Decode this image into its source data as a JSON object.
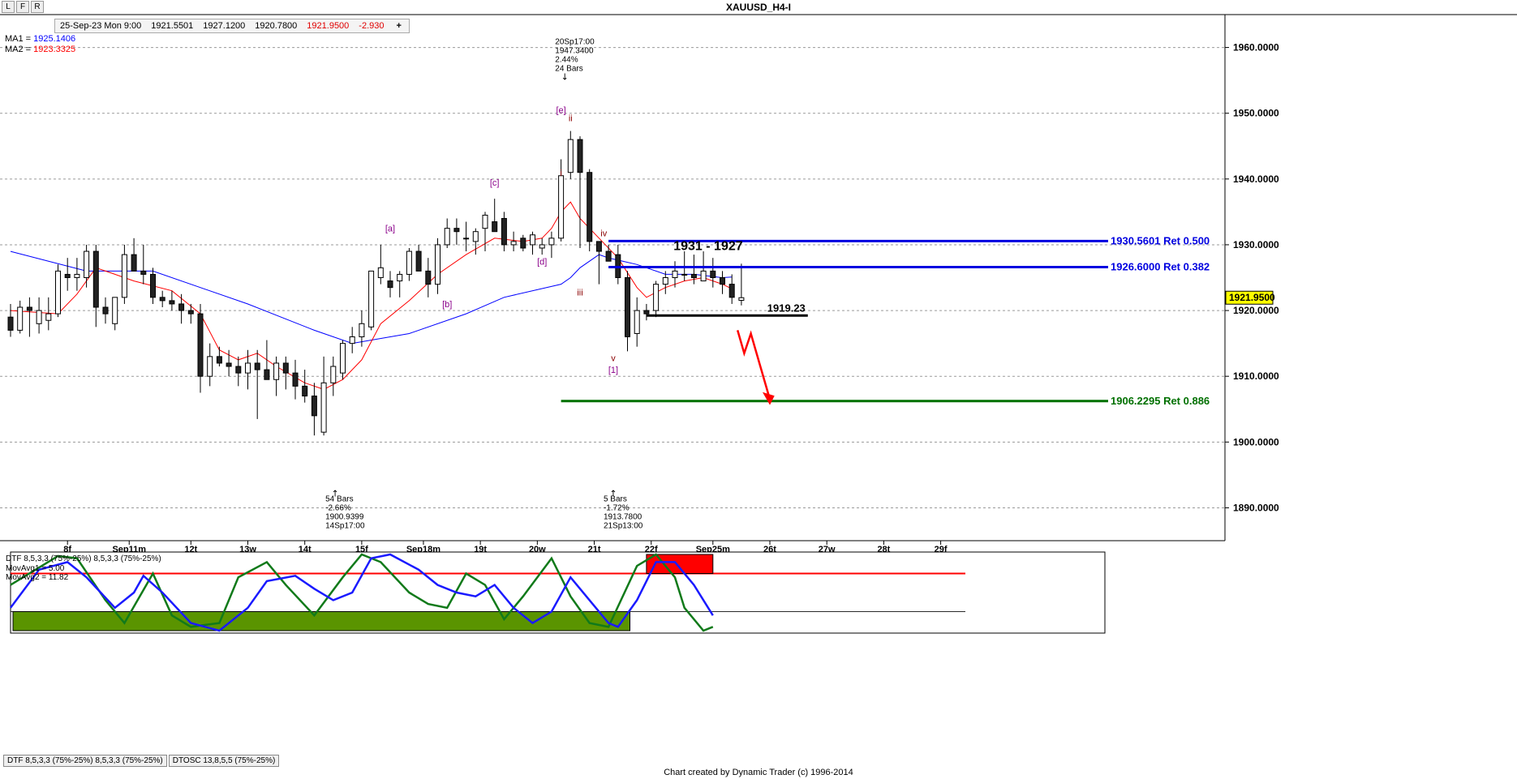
{
  "title": "XAUUSD_H4-I",
  "toolbar": {
    "buttons": [
      "L",
      "F",
      "R"
    ]
  },
  "ohlc": [
    "25-Sep-23 Mon 9:00",
    "1921.5501",
    "1927.1200",
    "1920.7800",
    "1921.9500",
    "-2.930"
  ],
  "add_symbol": "+",
  "footer": "Chart created by Dynamic Trader  (c) 1996-2014",
  "tabs": [
    "DTF 8,5,3,3 (75%-25%) 8,5,3,3 (75%-25%)",
    "DTOSC 13,8,5,5 (75%-25%)"
  ],
  "colors": {
    "ma1": "#0000ff",
    "ma2": "#ff0000",
    "price_tag": "#ffff00"
  },
  "chart_data": [
    {
      "type": "candlestick",
      "title": "XAUUSD_H4-I",
      "legend": [
        {
          "name": "MA1",
          "value": "1925.1406",
          "color": "#0000ff"
        },
        {
          "name": "MA2",
          "value": "1923.3325",
          "color": "#ff0000"
        }
      ],
      "ylim": [
        1885,
        1965
      ],
      "y_ticks": [
        "1890.0000",
        "1900.0000",
        "1910.0000",
        "1920.0000",
        "1930.0000",
        "1940.0000",
        "1950.0000",
        "1960.0000"
      ],
      "y_tick_values": [
        1890,
        1900,
        1910,
        1920,
        1930,
        1940,
        1950,
        1960
      ],
      "x_ticks": [
        {
          "label": "8f",
          "bar": 6
        },
        {
          "label": "Sep11m",
          "bar": 12.5
        },
        {
          "label": "12t",
          "bar": 19
        },
        {
          "label": "13w",
          "bar": 25
        },
        {
          "label": "14t",
          "bar": 31
        },
        {
          "label": "15f",
          "bar": 37
        },
        {
          "label": "Sep18m",
          "bar": 43.5
        },
        {
          "label": "19t",
          "bar": 49.5
        },
        {
          "label": "20w",
          "bar": 55.5
        },
        {
          "label": "21t",
          "bar": 61.5
        },
        {
          "label": "22f",
          "bar": 67.5
        },
        {
          "label": "Sep25m",
          "bar": 74
        },
        {
          "label": "26t",
          "bar": 80
        },
        {
          "label": "27w",
          "bar": 86
        },
        {
          "label": "28t",
          "bar": 92
        },
        {
          "label": "29f",
          "bar": 98
        }
      ],
      "candles": [
        [
          1919.0,
          1921.0,
          1916.0,
          1917.0
        ],
        [
          1917.0,
          1921.5,
          1916.5,
          1920.5
        ],
        [
          1920.5,
          1922.0,
          1916.0,
          1920.0
        ],
        [
          1918.0,
          1922.0,
          1916.5,
          1920.0
        ],
        [
          1918.5,
          1922.0,
          1917.0,
          1919.5
        ],
        [
          1919.5,
          1927.0,
          1919.0,
          1926.0
        ],
        [
          1925.5,
          1928.0,
          1923.0,
          1925.0
        ],
        [
          1925.0,
          1928.0,
          1923.0,
          1925.5
        ],
        [
          1925.0,
          1930.0,
          1923.5,
          1929.0
        ],
        [
          1929.0,
          1930.0,
          1917.5,
          1920.5
        ],
        [
          1920.5,
          1922.0,
          1918.0,
          1919.5
        ],
        [
          1918.0,
          1922.0,
          1917.0,
          1922.0
        ],
        [
          1922.0,
          1930.0,
          1921.0,
          1928.5
        ],
        [
          1928.5,
          1931.0,
          1926.0,
          1926.0
        ],
        [
          1926.0,
          1930.0,
          1924.0,
          1925.5
        ],
        [
          1925.5,
          1926.5,
          1921.0,
          1922.0
        ],
        [
          1922.0,
          1923.0,
          1920.5,
          1921.5
        ],
        [
          1921.5,
          1923.0,
          1920.0,
          1921.0
        ],
        [
          1921.0,
          1922.5,
          1918.0,
          1920.0
        ],
        [
          1920.0,
          1921.0,
          1918.0,
          1919.5
        ],
        [
          1919.5,
          1921.0,
          1907.5,
          1910.0
        ],
        [
          1910.0,
          1915.0,
          1908.5,
          1913.0
        ],
        [
          1913.0,
          1914.5,
          1911.5,
          1912.0
        ],
        [
          1912.0,
          1914.0,
          1910.0,
          1911.5
        ],
        [
          1911.5,
          1913.0,
          1908.5,
          1910.5
        ],
        [
          1910.5,
          1914.0,
          1908.0,
          1912.0
        ],
        [
          1912.0,
          1914.0,
          1903.5,
          1911.0
        ],
        [
          1911.0,
          1915.5,
          1910.0,
          1909.5
        ],
        [
          1909.5,
          1913.0,
          1907.0,
          1912.0
        ],
        [
          1912.0,
          1913.0,
          1908.0,
          1910.5
        ],
        [
          1910.5,
          1912.5,
          1906.5,
          1908.5
        ],
        [
          1908.5,
          1911.0,
          1906.0,
          1907.0
        ],
        [
          1907.0,
          1909.0,
          1901.0,
          1904.0
        ],
        [
          1901.5,
          1913.0,
          1901.0,
          1909.0
        ],
        [
          1909.0,
          1913.0,
          1907.0,
          1911.5
        ],
        [
          1910.5,
          1915.5,
          1909.5,
          1915.0
        ],
        [
          1915.0,
          1917.5,
          1913.5,
          1916.0
        ],
        [
          1916.0,
          1920.0,
          1914.5,
          1918.0
        ],
        [
          1917.5,
          1925.0,
          1917.0,
          1926.0
        ],
        [
          1925.0,
          1930.0,
          1924.0,
          1926.5
        ],
        [
          1924.5,
          1926.0,
          1922.0,
          1923.5
        ],
        [
          1924.5,
          1926.0,
          1922.0,
          1925.5
        ],
        [
          1925.5,
          1929.5,
          1924.5,
          1929.0
        ],
        [
          1929.0,
          1930.0,
          1926.0,
          1926.0
        ],
        [
          1926.0,
          1928.0,
          1922.0,
          1924.0
        ],
        [
          1924.0,
          1931.0,
          1922.5,
          1930.0
        ],
        [
          1930.0,
          1934.0,
          1929.5,
          1932.5
        ],
        [
          1932.5,
          1934.0,
          1930.0,
          1932.0
        ],
        [
          1931.0,
          1933.5,
          1929.0,
          1931.0
        ],
        [
          1930.5,
          1932.5,
          1928.5,
          1932.0
        ],
        [
          1932.5,
          1935.0,
          1929.0,
          1934.5
        ],
        [
          1933.5,
          1937.0,
          1932.5,
          1932.0
        ],
        [
          1934.0,
          1935.0,
          1929.0,
          1930.0
        ],
        [
          1930.0,
          1932.0,
          1929.0,
          1930.5
        ],
        [
          1931.0,
          1931.5,
          1929.0,
          1929.5
        ],
        [
          1930.0,
          1932.0,
          1928.5,
          1931.5
        ],
        [
          1929.5,
          1931.0,
          1928.5,
          1930.0
        ],
        [
          1930.0,
          1932.0,
          1928.0,
          1931.0
        ],
        [
          1931.0,
          1943.0,
          1930.5,
          1940.5
        ],
        [
          1941.0,
          1947.3,
          1940.0,
          1946.0
        ],
        [
          1946.0,
          1946.5,
          1929.5,
          1941.0
        ],
        [
          1941.0,
          1941.5,
          1929.0,
          1930.5
        ],
        [
          1930.5,
          1930.5,
          1924.0,
          1929.0
        ],
        [
          1929.0,
          1930.0,
          1927.5,
          1927.5
        ],
        [
          1928.5,
          1930.0,
          1924.0,
          1925.0
        ],
        [
          1925.0,
          1926.0,
          1913.8,
          1916.0
        ],
        [
          1916.5,
          1922.0,
          1914.5,
          1920.0
        ],
        [
          1920.0,
          1921.0,
          1918.5,
          1919.5
        ],
        [
          1920.0,
          1924.5,
          1919.0,
          1924.0
        ],
        [
          1924.0,
          1926.0,
          1922.5,
          1925.0
        ],
        [
          1925.0,
          1927.5,
          1923.5,
          1926.0
        ],
        [
          1925.5,
          1929.0,
          1924.5,
          1925.5
        ],
        [
          1925.5,
          1928.5,
          1924.0,
          1925.0
        ],
        [
          1924.5,
          1929.0,
          1924.5,
          1926.0
        ],
        [
          1926.0,
          1928.0,
          1923.5,
          1925.0
        ],
        [
          1925.0,
          1926.0,
          1922.5,
          1924.0
        ],
        [
          1924.0,
          1925.5,
          1921.0,
          1922.0
        ],
        [
          1921.55,
          1927.12,
          1920.78,
          1921.95
        ]
      ],
      "ma1_blue": [
        [
          0,
          1929.0
        ],
        [
          8,
          1926.0
        ],
        [
          15,
          1926.0
        ],
        [
          25,
          1921.0
        ],
        [
          32,
          1917.0
        ],
        [
          36,
          1915.0
        ],
        [
          42,
          1916.5
        ],
        [
          48,
          1919.5
        ],
        [
          52,
          1922.0
        ],
        [
          58,
          1924.0
        ],
        [
          59,
          1925.0
        ],
        [
          60,
          1926.5
        ],
        [
          62,
          1928.5
        ],
        [
          63,
          1928.0
        ],
        [
          66,
          1927.0
        ],
        [
          69,
          1925.5
        ],
        [
          72,
          1925.5
        ],
        [
          75,
          1925.0
        ],
        [
          76,
          1925.1
        ]
      ],
      "ma2_red": [
        [
          0,
          1920.0
        ],
        [
          5,
          1919.5
        ],
        [
          7,
          1922.5
        ],
        [
          9,
          1926.5
        ],
        [
          11,
          1925.5
        ],
        [
          13,
          1924.5
        ],
        [
          17,
          1923.0
        ],
        [
          20,
          1919.5
        ],
        [
          22,
          1914.0
        ],
        [
          24,
          1912.5
        ],
        [
          26,
          1913.5
        ],
        [
          28,
          1911.5
        ],
        [
          31,
          1909.0
        ],
        [
          33,
          1908.0
        ],
        [
          35,
          1909.5
        ],
        [
          37,
          1912.5
        ],
        [
          39,
          1918.0
        ],
        [
          42,
          1921.5
        ],
        [
          45,
          1925.5
        ],
        [
          48,
          1928.5
        ],
        [
          51,
          1931.0
        ],
        [
          54,
          1930.5
        ],
        [
          56,
          1931.0
        ],
        [
          57,
          1932.5
        ],
        [
          58,
          1935.0
        ],
        [
          59,
          1936.5
        ],
        [
          60,
          1934.0
        ],
        [
          62,
          1931.0
        ],
        [
          64,
          1928.0
        ],
        [
          66,
          1923.5
        ],
        [
          67,
          1922.0
        ],
        [
          69,
          1923.5
        ],
        [
          71,
          1924.5
        ],
        [
          73,
          1925.0
        ],
        [
          75,
          1924.0
        ],
        [
          76,
          1923.3
        ]
      ],
      "horizontal_levels": [
        {
          "label": "1930.5601 Ret 0.500",
          "value": 1930.5601,
          "color": "#0000e0",
          "from_bar": 63
        },
        {
          "label": "1926.6000 Ret 0.382",
          "value": 1926.6,
          "color": "#0000e0",
          "from_bar": 63
        },
        {
          "label": "1906.2295 Ret 0.886",
          "value": 1906.2295,
          "color": "#007000",
          "from_bar": 58
        },
        {
          "label": "1919.23",
          "value": 1919.23,
          "color": "#000000",
          "from_bar": 67,
          "to_bar": 84
        }
      ],
      "range_label": "1931 - 1927",
      "last_price": "1921.9500",
      "wave_labels": [
        {
          "text": "[a]",
          "bar": 40,
          "value": 1932.0,
          "color": "#8a008a"
        },
        {
          "text": "[b]",
          "bar": 46,
          "value": 1920.5,
          "color": "#8a008a"
        },
        {
          "text": "[c]",
          "bar": 51,
          "value": 1939.0,
          "color": "#8a008a"
        },
        {
          "text": "[d]",
          "bar": 56,
          "value": 1927.0,
          "color": "#8a008a"
        },
        {
          "text": "[e]",
          "bar": 58,
          "value": 1950.0,
          "color": "#8a008a"
        },
        {
          "text": "ii",
          "bar": 59,
          "value": 1948.8,
          "color": "#8a0000"
        },
        {
          "text": "i",
          "bar": 58,
          "value": 1940.5,
          "color": "#8a0000"
        },
        {
          "text": "iv",
          "bar": 62.5,
          "value": 1931.3,
          "color": "#8a0000"
        },
        {
          "text": "iii",
          "bar": 60,
          "value": 1922.3,
          "color": "#8a0000"
        },
        {
          "text": "v",
          "bar": 63.5,
          "value": 1912.3,
          "color": "#8a0000"
        },
        {
          "text": "[1]",
          "bar": 63.5,
          "value": 1910.5,
          "color": "#8a008a"
        }
      ],
      "info_boxes": [
        {
          "bar": 58.4,
          "value": 1960.5,
          "arrow": "down",
          "lines": [
            "20Sp17:00",
            "1947.3400",
            "2.44%",
            "24 Bars"
          ]
        },
        {
          "bar": 34.2,
          "value": 1891.0,
          "arrow": "up",
          "lines": [
            "54 Bars",
            "-2.66%",
            "1900.9399",
            "14Sp17:00"
          ]
        },
        {
          "bar": 63.5,
          "value": 1891.0,
          "arrow": "up",
          "lines": [
            "5 Bars",
            "-1.72%",
            "1913.7800",
            "21Sp13:00"
          ]
        }
      ],
      "projection_path": [
        [
          76.6,
          1917.0
        ],
        [
          77.3,
          1913.5
        ],
        [
          78,
          1916.5
        ],
        [
          80,
          1906.5
        ]
      ]
    },
    {
      "type": "line",
      "title": "DTF 8,5,3,3 (75%-25%) 8,5,3,3 (75%-25%)",
      "legend": [
        {
          "name": "MovAvg1",
          "value": "5.00",
          "color": "#006400"
        },
        {
          "name": "MovAvg2",
          "value": "11.82",
          "color": "#0000ff"
        }
      ],
      "ylim": [
        0,
        100
      ],
      "overbought": 75,
      "oversold": 25,
      "fast_green": [
        [
          0,
          60
        ],
        [
          5,
          98
        ],
        [
          7,
          95
        ],
        [
          10,
          40
        ],
        [
          12,
          10
        ],
        [
          15,
          75
        ],
        [
          17,
          20
        ],
        [
          19,
          5
        ],
        [
          22,
          10
        ],
        [
          24,
          70
        ],
        [
          27,
          90
        ],
        [
          29,
          60
        ],
        [
          32,
          20
        ],
        [
          35,
          70
        ],
        [
          37,
          100
        ],
        [
          39,
          90
        ],
        [
          42,
          50
        ],
        [
          44,
          35
        ],
        [
          46,
          30
        ],
        [
          48,
          75
        ],
        [
          50,
          60
        ],
        [
          52,
          15
        ],
        [
          54,
          45
        ],
        [
          57,
          95
        ],
        [
          59,
          45
        ],
        [
          61,
          10
        ],
        [
          63,
          5
        ],
        [
          66,
          85
        ],
        [
          68,
          100
        ],
        [
          70,
          70
        ],
        [
          71,
          30
        ],
        [
          73,
          0
        ],
        [
          74,
          5
        ]
      ],
      "slow_blue": [
        [
          0,
          30
        ],
        [
          3,
          80
        ],
        [
          6,
          90
        ],
        [
          8,
          70
        ],
        [
          11,
          30
        ],
        [
          13,
          50
        ],
        [
          14,
          72
        ],
        [
          16,
          50
        ],
        [
          19,
          10
        ],
        [
          22,
          0
        ],
        [
          25,
          30
        ],
        [
          27,
          65
        ],
        [
          30,
          72
        ],
        [
          32,
          55
        ],
        [
          34,
          40
        ],
        [
          36,
          50
        ],
        [
          38,
          95
        ],
        [
          40,
          100
        ],
        [
          43,
          80
        ],
        [
          45,
          60
        ],
        [
          47,
          50
        ],
        [
          49,
          45
        ],
        [
          51,
          60
        ],
        [
          53,
          30
        ],
        [
          55,
          10
        ],
        [
          57,
          25
        ],
        [
          59,
          70
        ],
        [
          61,
          40
        ],
        [
          63,
          10
        ],
        [
          64,
          5
        ],
        [
          66,
          40
        ],
        [
          68,
          90
        ],
        [
          70,
          90
        ],
        [
          72,
          60
        ],
        [
          74,
          20
        ]
      ],
      "ob_zone": {
        "from_bar": 67,
        "to_bar": 74,
        "color": "#ff0000"
      },
      "os_zone": {
        "from_bar": -1,
        "to_bar": 65,
        "color": "#5a9400"
      }
    }
  ]
}
